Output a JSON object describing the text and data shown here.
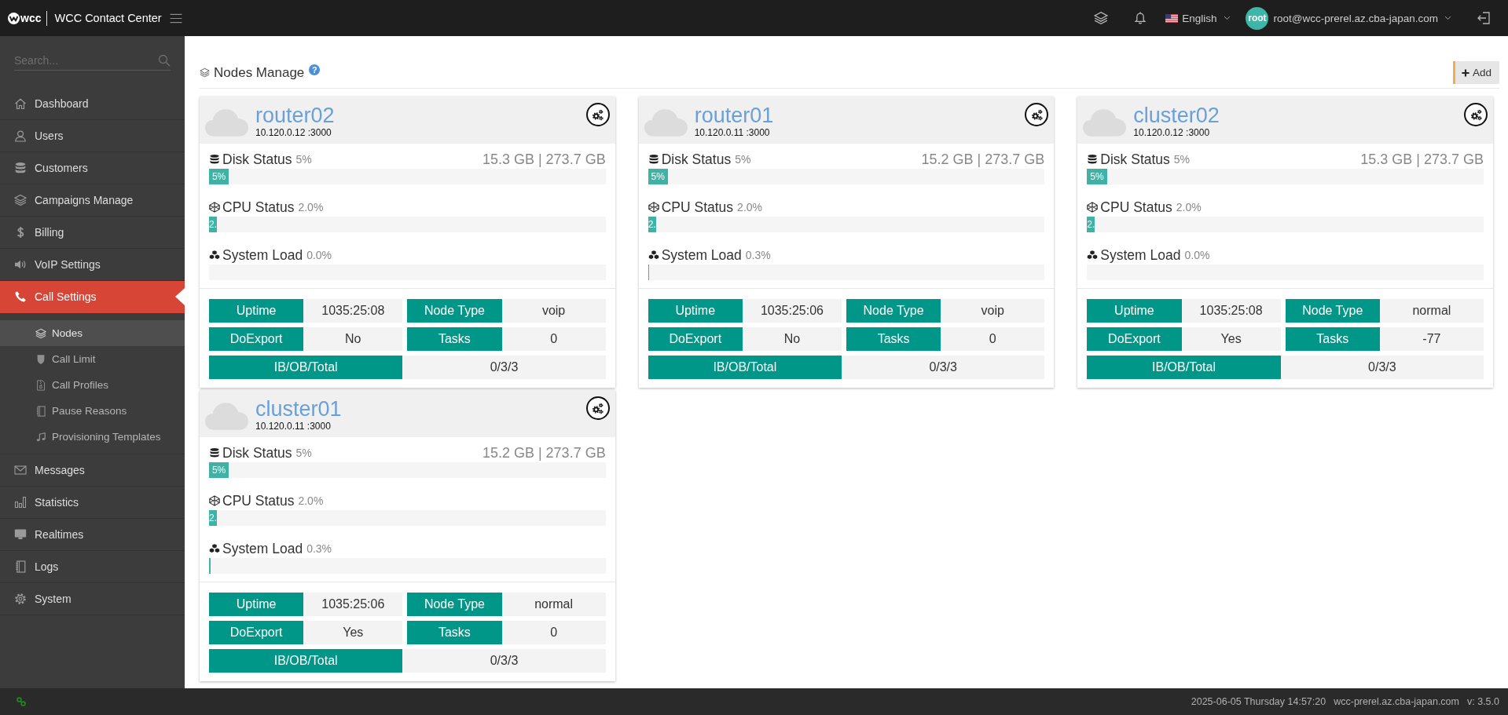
{
  "top_bar": {
    "logo_text": "wcc",
    "title": "WCC Contact Center",
    "language": "English",
    "avatar_text": "root",
    "user": "root@wcc-prerel.az.cba-japan.com"
  },
  "sidebar": {
    "search": {
      "placeholder": "Search..."
    },
    "items": [
      {
        "label": "Dashboard",
        "selected": false
      },
      {
        "label": "Users",
        "selected": false
      },
      {
        "label": "Customers",
        "selected": false
      },
      {
        "label": "Campaigns Manage",
        "selected": false
      },
      {
        "label": "Billing",
        "selected": false
      },
      {
        "label": "VoIP Settings",
        "selected": false
      },
      {
        "label": "Call Settings",
        "selected": true,
        "children": [
          {
            "label": "Nodes",
            "selected": true
          },
          {
            "label": "Call Limit",
            "selected": false
          },
          {
            "label": "Call Profiles",
            "selected": false
          },
          {
            "label": "Pause Reasons",
            "selected": false
          },
          {
            "label": "Provisioning Templates",
            "selected": false
          }
        ]
      },
      {
        "label": "Messages",
        "selected": false
      },
      {
        "label": "Statistics",
        "selected": false
      },
      {
        "label": "Realtimes",
        "selected": false
      },
      {
        "label": "Logs",
        "selected": false
      },
      {
        "label": "System",
        "selected": false
      }
    ]
  },
  "page": {
    "title": "Nodes Manage",
    "help_button": "?",
    "add_button": "Add"
  },
  "nodes": [
    {
      "name": "router02",
      "address": "10.120.0.12 :3000",
      "metrics": [
        {
          "label": "Disk Status",
          "reading": "5%",
          "usage": "15.3 GB | 273.7 GB",
          "level": 0.05,
          "bar_label": "5%"
        },
        {
          "label": "CPU Status",
          "reading": "2.0%",
          "level": 0.02,
          "bar_label": "2."
        },
        {
          "label": "System Load",
          "reading": "0.0%",
          "level": 0
        }
      ],
      "info": [
        {
          "label": "Uptime",
          "value": "1035:25:08"
        },
        {
          "label": "Node Type",
          "value": "voip"
        },
        {
          "label": "DoExport",
          "value": "No"
        },
        {
          "label": "Tasks",
          "value": "0"
        },
        {
          "label": "IB/OB/Total",
          "value": "0/3/3"
        }
      ]
    },
    {
      "name": "router01",
      "address": "10.120.0.11 :3000",
      "metrics": [
        {
          "label": "Disk Status",
          "reading": "5%",
          "usage": "15.2 GB | 273.7 GB",
          "level": 0.05,
          "bar_label": "5%"
        },
        {
          "label": "CPU Status",
          "reading": "2.0%",
          "level": 0.02,
          "bar_label": "2."
        },
        {
          "label": "System Load",
          "reading": "0.3%",
          "level": 0.003
        }
      ],
      "info": [
        {
          "label": "Uptime",
          "value": "1035:25:06"
        },
        {
          "label": "Node Type",
          "value": "voip"
        },
        {
          "label": "DoExport",
          "value": "No"
        },
        {
          "label": "Tasks",
          "value": "0"
        },
        {
          "label": "IB/OB/Total",
          "value": "0/3/3"
        }
      ]
    },
    {
      "name": "cluster02",
      "address": "10.120.0.12 :3000",
      "metrics": [
        {
          "label": "Disk Status",
          "reading": "5%",
          "usage": "15.3 GB | 273.7 GB",
          "level": 0.05,
          "bar_label": "5%"
        },
        {
          "label": "CPU Status",
          "reading": "2.0%",
          "level": 0.02,
          "bar_label": "2."
        },
        {
          "label": "System Load",
          "reading": "0.0%",
          "level": 0
        }
      ],
      "info": [
        {
          "label": "Uptime",
          "value": "1035:25:08"
        },
        {
          "label": "Node Type",
          "value": "normal"
        },
        {
          "label": "DoExport",
          "value": "Yes"
        },
        {
          "label": "Tasks",
          "value": "-77"
        },
        {
          "label": "IB/OB/Total",
          "value": "0/3/3"
        }
      ]
    },
    {
      "name": "cluster01",
      "address": "10.120.0.11 :3000",
      "metrics": [
        {
          "label": "Disk Status",
          "reading": "5%",
          "usage": "15.2 GB | 273.7 GB",
          "level": 0.05,
          "bar_label": "5%"
        },
        {
          "label": "CPU Status",
          "reading": "2.0%",
          "level": 0.02,
          "bar_label": "2."
        },
        {
          "label": "System Load",
          "reading": "0.3%",
          "level": 0.003
        }
      ],
      "info": [
        {
          "label": "Uptime",
          "value": "1035:25:06"
        },
        {
          "label": "Node Type",
          "value": "normal"
        },
        {
          "label": "DoExport",
          "value": "Yes"
        },
        {
          "label": "Tasks",
          "value": "0"
        },
        {
          "label": "IB/OB/Total",
          "value": "0/3/3"
        }
      ]
    }
  ],
  "footer": {
    "datetime": "2025-06-05 Thursday 14:57:20",
    "host": "wcc-prerel.az.cba-japan.com",
    "version": "v: 3.5.0"
  }
}
